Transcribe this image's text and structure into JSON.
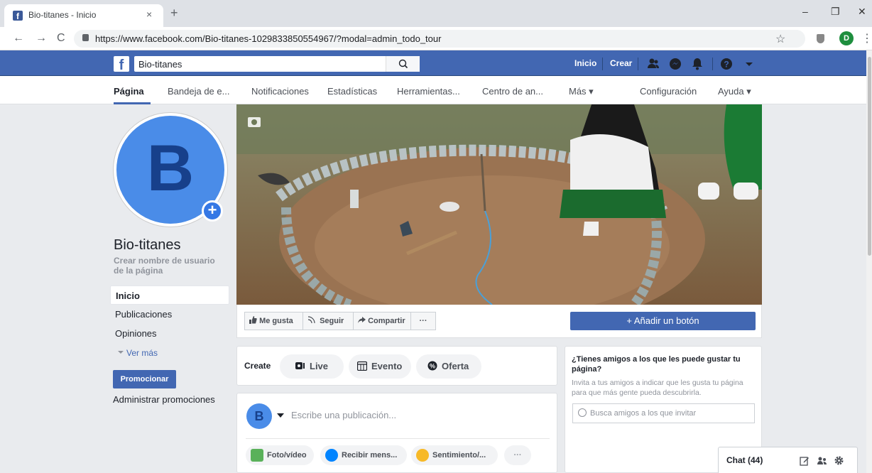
{
  "browser": {
    "tab_title": "Bio-titanes - Inicio",
    "tab_close": "×",
    "new_tab": "+",
    "url": "https://www.facebook.com/Bio-titanes-1029833850554967/?modal=admin_todo_tour",
    "profile_initial": "D",
    "controls": {
      "minimize": "–",
      "restore": "❐",
      "close": "✕"
    },
    "nav": {
      "back": "←",
      "forward": "→",
      "reload": "C"
    },
    "star": "☆",
    "menu": "⋮"
  },
  "topbar": {
    "logo": "f",
    "search_value": "Bio-titanes",
    "inicio": "Inicio",
    "crear": "Crear",
    "colors": {
      "bar": "#4267b2",
      "accent": "#3578e5"
    }
  },
  "pagetabs": [
    {
      "label": "Página"
    },
    {
      "label": "Bandeja de e..."
    },
    {
      "label": "Notificaciones"
    },
    {
      "label": "Estadísticas"
    },
    {
      "label": "Herramientas..."
    },
    {
      "label": "Centro de an..."
    },
    {
      "label": "Más ▾"
    },
    {
      "label": "Configuración"
    },
    {
      "label": "Ayuda ▾"
    }
  ],
  "profile": {
    "letter": "B",
    "add": "+",
    "name": "Bio-titanes",
    "username_prompt": "Crear nombre de usuario de la página"
  },
  "leftnav": {
    "items": [
      {
        "label": "Inicio"
      },
      {
        "label": "Publicaciones"
      },
      {
        "label": "Opiniones"
      }
    ],
    "ver_mas": "Ver más",
    "promote": "Promocionar",
    "manage_promos": "Administrar promociones"
  },
  "cover_actions": {
    "like": "Me gusta",
    "follow": "Seguir",
    "share": "Compartir",
    "more": "···",
    "add_button": "+ Añadir un botón"
  },
  "create": {
    "label": "Create",
    "items": [
      {
        "label": "Live"
      },
      {
        "label": "Evento"
      },
      {
        "label": "Oferta"
      }
    ]
  },
  "composer": {
    "avatar_letter": "B",
    "placeholder": "Escribe una publicación...",
    "actions": [
      {
        "label": "Foto/vídeo"
      },
      {
        "label": "Recibir mens..."
      },
      {
        "label": "Sentimiento/..."
      },
      {
        "label": "···"
      }
    ]
  },
  "invite": {
    "title": "¿Tienes amigos a los que les puede gustar tu página?",
    "description": "Invita a tus amigos a indicar que les gusta tu página para que más gente pueda descubrirla.",
    "search_placeholder": "Busca amigos a los que invitar"
  },
  "chat": {
    "label": "Chat (44)"
  }
}
